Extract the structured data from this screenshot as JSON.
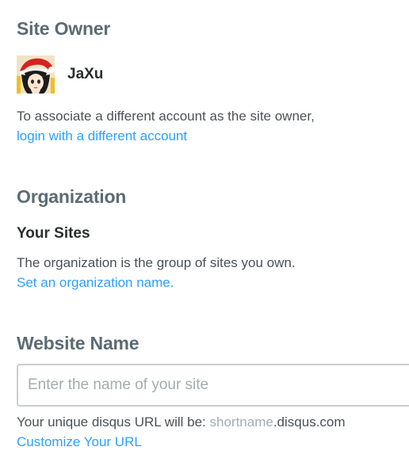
{
  "owner": {
    "heading": "Site Owner",
    "name": "JaXu",
    "description": "To associate a different account as the site owner,",
    "switch_link": "login with a different account"
  },
  "organization": {
    "heading": "Organization",
    "subheading": "Your Sites",
    "description": "The organization is the group of sites you own.",
    "set_name_link": "Set an organization name."
  },
  "website": {
    "heading": "Website Name",
    "input_placeholder": "Enter the name of your site",
    "input_value": "",
    "url_prefix": "Your unique disqus URL will be: ",
    "url_shortname": "shortname",
    "url_suffix": ".disqus.com",
    "customize_link": "Customize Your URL"
  },
  "colors": {
    "heading": "#5c6b73",
    "link": "#2e9fff",
    "body_text": "#4b5157",
    "placeholder": "#a3acb0"
  }
}
